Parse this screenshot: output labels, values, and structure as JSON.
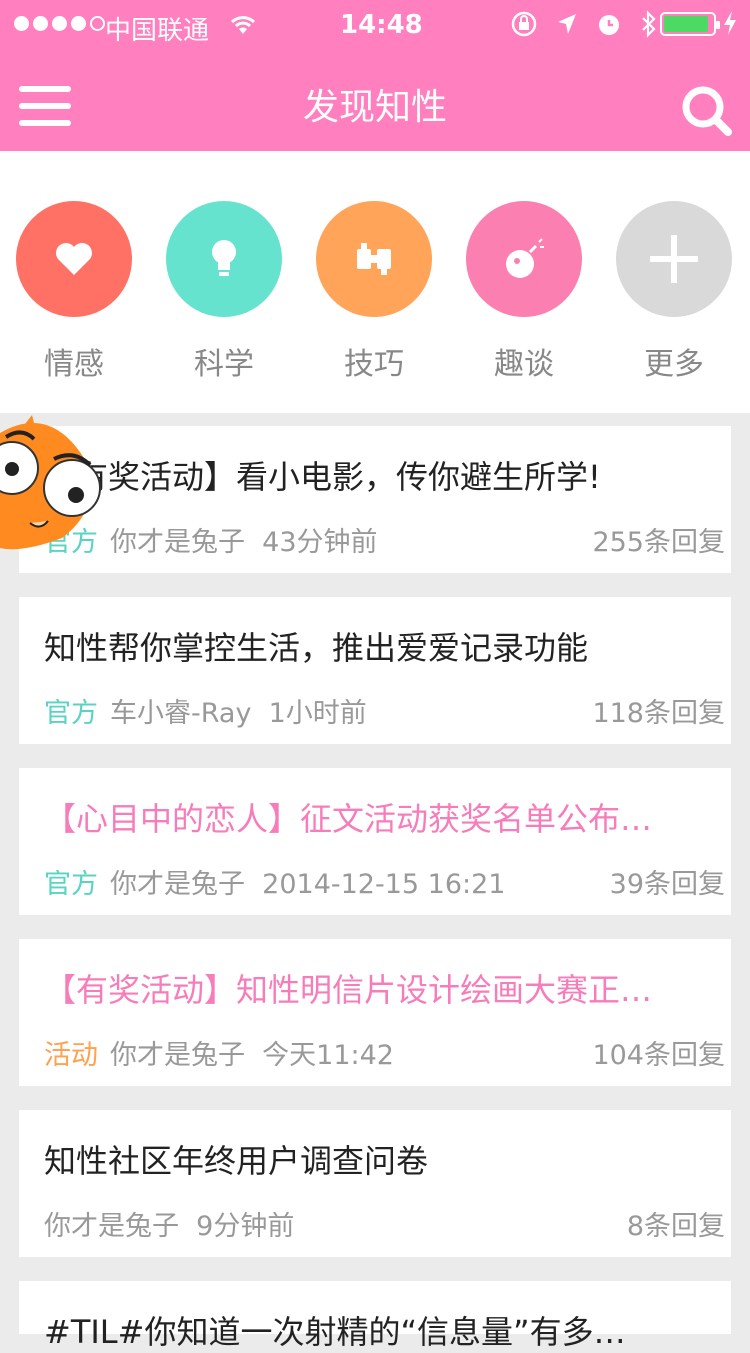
{
  "status_bar": {
    "carrier": "中国联通",
    "time": "14:48"
  },
  "nav": {
    "title": "发现知性"
  },
  "categories": [
    {
      "label": "情感",
      "color": "#ff7165",
      "icon": "heart-icon"
    },
    {
      "label": "科学",
      "color": "#66e3cf",
      "icon": "lightbulb-icon"
    },
    {
      "label": "技巧",
      "color": "#ffa459",
      "icon": "puzzle-icon"
    },
    {
      "label": "趣谈",
      "color": "#fb7fb0",
      "icon": "bomb-icon"
    },
    {
      "label": "更多",
      "color": "#d9d9d9",
      "icon": "plus-icon"
    }
  ],
  "posts": [
    {
      "title": "【有奖活动】看小电影，传你避生所学!",
      "tag": "官方",
      "author": "你才是兔子",
      "time": "43分钟前",
      "replies": "255条回复"
    },
    {
      "title": "知性帮你掌控生活，推出爱爱记录功能",
      "tag": "官方",
      "author": "车小睿-Ray",
      "time": "1小时前",
      "replies": "118条回复"
    },
    {
      "title": "【心目中的恋人】征文活动获奖名单公布…",
      "tag": "官方",
      "author": "你才是兔子",
      "time": "2014-12-15 16:21",
      "replies": "39条回复"
    },
    {
      "title": "【有奖活动】知性明信片设计绘画大赛正…",
      "tag": "活动",
      "author": "你才是兔子",
      "time": "今天11:42",
      "replies": "104条回复"
    },
    {
      "title": "知性社区年终用户调查问卷",
      "tag": "",
      "author": "你才是兔子",
      "time": "9分钟前",
      "replies": "8条回复"
    },
    {
      "title": "#TIL#你知道一次射精的“信息量”有多…",
      "tag": "",
      "author": "",
      "time": "",
      "replies": ""
    }
  ],
  "colors": {
    "header": "#ff7fbf",
    "official_tag": "#59d4c2",
    "activity_tag": "#ffa14d",
    "pink_title": "#f77cba"
  }
}
